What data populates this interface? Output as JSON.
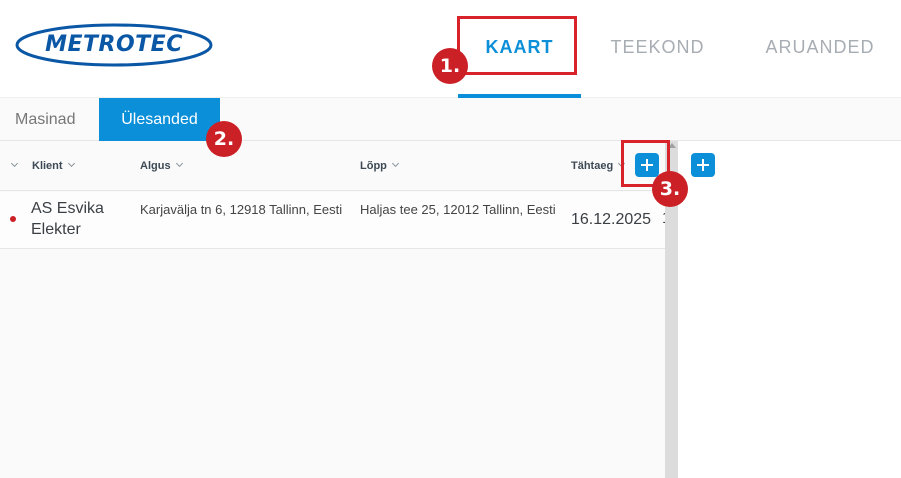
{
  "header": {
    "logo_text": "METROTEC",
    "nav_tabs": [
      {
        "label": "KAART",
        "active": true
      },
      {
        "label": "TEEKOND",
        "active": false
      },
      {
        "label": "ARUANDED",
        "active": false
      }
    ]
  },
  "annotations": [
    {
      "number": "1."
    },
    {
      "number": "2."
    },
    {
      "number": "3."
    }
  ],
  "subtabs": [
    {
      "label": "Masinad",
      "active": false
    },
    {
      "label": "Ülesanded",
      "active": true
    }
  ],
  "table": {
    "columns": [
      "Klient",
      "Algus",
      "Lõpp",
      "Tähtaeg"
    ],
    "rows": [
      {
        "klient": "AS Esvika Elekter",
        "algus": "Karjavälja tn 6, 12918 Tallinn, Eesti",
        "lopp": "Haljas tee 25, 12012 Tallinn, Eesti",
        "tahtaeg": "16.12.2025",
        "more": "1",
        "status_color": "#cc2027"
      }
    ]
  },
  "colors": {
    "accent": "#0a8fd8",
    "brand": "#0a57a6",
    "annotation": "#d8232a"
  },
  "icons": [
    "chevron-down-icon",
    "plus-icon",
    "status-dot-icon"
  ]
}
